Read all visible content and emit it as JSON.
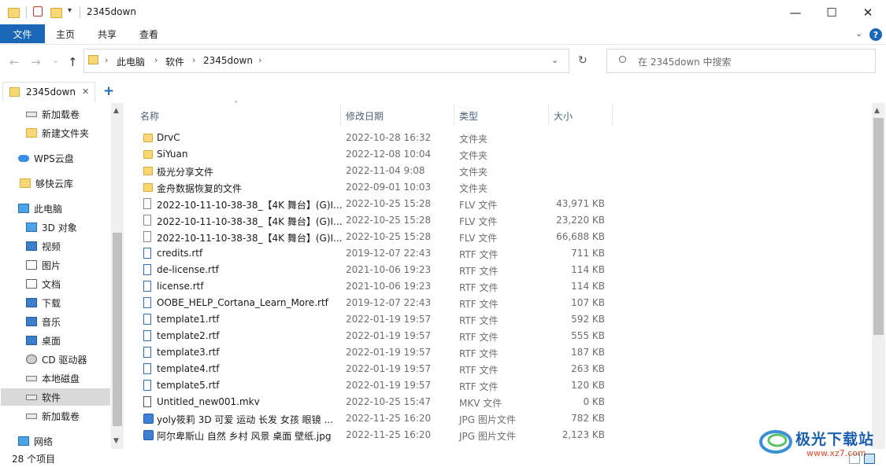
{
  "window": {
    "title": "2345down",
    "minimize": "—",
    "maximize": "☐",
    "close": "✕"
  },
  "ribbon": {
    "tabs": [
      "文件",
      "主页",
      "共享",
      "查看"
    ],
    "expand_icon": "chevron-down-icon",
    "help_label": "?"
  },
  "address": {
    "back": "←",
    "forward": "→",
    "history": "⌄",
    "up": "↑",
    "crumbs": [
      "此电脑",
      "软件",
      "2345down"
    ],
    "dropdown": "⌄",
    "refresh": "↻"
  },
  "search": {
    "placeholder": "在 2345down 中搜索"
  },
  "doc_tab": {
    "label": "2345down",
    "close": "✕",
    "add": "+"
  },
  "sidebar": {
    "items": [
      {
        "label": "新加载卷",
        "icon": "drive-icon"
      },
      {
        "label": "新建文件夹",
        "icon": "folder-icon"
      },
      {
        "label": "WPS云盘",
        "icon": "cloud-icon"
      },
      {
        "label": "够快云库",
        "icon": "folder-icon"
      },
      {
        "label": "此电脑",
        "icon": "pc-icon"
      },
      {
        "label": "3D 对象",
        "icon": "cube-icon"
      },
      {
        "label": "视频",
        "icon": "video-icon"
      },
      {
        "label": "图片",
        "icon": "picture-icon"
      },
      {
        "label": "文档",
        "icon": "document-icon"
      },
      {
        "label": "下载",
        "icon": "download-icon"
      },
      {
        "label": "音乐",
        "icon": "music-icon"
      },
      {
        "label": "桌面",
        "icon": "desktop-icon"
      },
      {
        "label": "CD 驱动器",
        "icon": "cd-drive-icon"
      },
      {
        "label": "本地磁盘",
        "icon": "drive-icon"
      },
      {
        "label": "软件",
        "icon": "drive-icon",
        "selected": true
      },
      {
        "label": "新加载卷",
        "icon": "drive-icon"
      },
      {
        "label": "网络",
        "icon": "network-icon"
      }
    ]
  },
  "columns": {
    "name": "名称",
    "date": "修改日期",
    "type": "类型",
    "size": "大小"
  },
  "files": [
    {
      "name": "DrvC",
      "date": "2022-10-28 16:32",
      "type": "文件夹",
      "size": "",
      "icon": "folder"
    },
    {
      "name": "SiYuan",
      "date": "2022-12-08 10:04",
      "type": "文件夹",
      "size": "",
      "icon": "folder"
    },
    {
      "name": "极光分享文件",
      "date": "2022-11-04 9:08",
      "type": "文件夹",
      "size": "",
      "icon": "folder"
    },
    {
      "name": "金舟数据恢复的文件",
      "date": "2022-09-01 10:03",
      "type": "文件夹",
      "size": "",
      "icon": "folder"
    },
    {
      "name": "2022-10-11-10-38-38_【4K 舞台】(G)I...",
      "date": "2022-10-25 15:28",
      "type": "FLV 文件",
      "size": "43,971 KB",
      "icon": "file"
    },
    {
      "name": "2022-10-11-10-38-38_【4K 舞台】(G)I...",
      "date": "2022-10-25 15:28",
      "type": "FLV 文件",
      "size": "23,220 KB",
      "icon": "file"
    },
    {
      "name": "2022-10-11-10-38-38_【4K 舞台】(G)I...",
      "date": "2022-10-25 15:28",
      "type": "FLV 文件",
      "size": "66,688 KB",
      "icon": "file"
    },
    {
      "name": "credits.rtf",
      "date": "2019-12-07 22:43",
      "type": "RTF 文件",
      "size": "711 KB",
      "icon": "rtf"
    },
    {
      "name": "de-license.rtf",
      "date": "2021-10-06 19:23",
      "type": "RTF 文件",
      "size": "114 KB",
      "icon": "rtf"
    },
    {
      "name": "license.rtf",
      "date": "2021-10-06 19:23",
      "type": "RTF 文件",
      "size": "114 KB",
      "icon": "rtf"
    },
    {
      "name": "OOBE_HELP_Cortana_Learn_More.rtf",
      "date": "2019-12-07 22:43",
      "type": "RTF 文件",
      "size": "107 KB",
      "icon": "rtf"
    },
    {
      "name": "template1.rtf",
      "date": "2022-01-19 19:57",
      "type": "RTF 文件",
      "size": "592 KB",
      "icon": "rtf"
    },
    {
      "name": "template2.rtf",
      "date": "2022-01-19 19:57",
      "type": "RTF 文件",
      "size": "555 KB",
      "icon": "rtf"
    },
    {
      "name": "template3.rtf",
      "date": "2022-01-19 19:57",
      "type": "RTF 文件",
      "size": "187 KB",
      "icon": "rtf"
    },
    {
      "name": "template4.rtf",
      "date": "2022-01-19 19:57",
      "type": "RTF 文件",
      "size": "263 KB",
      "icon": "rtf"
    },
    {
      "name": "template5.rtf",
      "date": "2022-01-19 19:57",
      "type": "RTF 文件",
      "size": "120 KB",
      "icon": "rtf"
    },
    {
      "name": "Untitled_new001.mkv",
      "date": "2022-10-25 15:47",
      "type": "MKV 文件",
      "size": "0 KB",
      "icon": "mkv"
    },
    {
      "name": "yoly筱莉 3D 可爱 运动 长发 女孩 眼镜 ...",
      "date": "2022-11-25 16:20",
      "type": "JPG 图片文件",
      "size": "782 KB",
      "icon": "jpg"
    },
    {
      "name": "阿尔卑斯山 自然 乡村 风景 桌面 壁纸.jpg",
      "date": "2022-11-25 16:20",
      "type": "JPG 图片文件",
      "size": "2,123 KB",
      "icon": "jpg"
    }
  ],
  "status": {
    "count": "28 个项目"
  },
  "watermark": {
    "text": "极光下载站",
    "url": "www.xz7.com"
  },
  "colors": {
    "accent": "#1a67b8",
    "folder": "#f8d775",
    "selected": "#d9d9d9"
  }
}
